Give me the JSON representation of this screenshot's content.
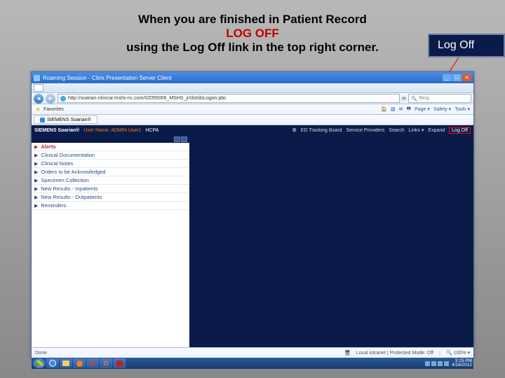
{
  "slide": {
    "line1": "When you are finished in Patient Record",
    "logoff": "LOG OFF",
    "line3": "using the Log Off link in the top right corner."
  },
  "callout": {
    "label": "Log Off"
  },
  "window": {
    "title": "Roaming Session - Citrix Presentation Server Client",
    "min": "_",
    "max": "☐",
    "close": "✕"
  },
  "ie": {
    "tabbar_label": "SIEMENS Soarian®",
    "back": "◄",
    "forward": "►",
    "url": "http://soarian-clinical.mshs-nc.com/02055006_MSHS_jr/dst/dsLogon.pbc",
    "refresh": "⟳",
    "search_placeholder": "Bing",
    "fav_label": "Favorites",
    "toolbar_items": [
      "Page ▾",
      "Safety ▾",
      "Tools ▾"
    ],
    "toolbar_icons": [
      "home-icon",
      "feed-icon",
      "mail-icon",
      "print-icon"
    ]
  },
  "app": {
    "brand": "SIEMENS Soarian®",
    "user_label": "User Name: ADMIN User1",
    "hipaa": "HCPA",
    "header_right": [
      {
        "label": "ED Tracking Board"
      },
      {
        "label": "Service Providers"
      },
      {
        "label": "Search"
      },
      {
        "label": "Links ▾"
      },
      {
        "label": "Expand"
      }
    ],
    "logoff_label": "Log Off"
  },
  "sidebar": {
    "items": [
      {
        "label": "Alerts",
        "alert": true
      },
      {
        "label": "Clinical Documentation"
      },
      {
        "label": "Clinical Notes"
      },
      {
        "label": "Orders to be Acknowledged"
      },
      {
        "label": "Specimen Collection"
      },
      {
        "label": "New Results - Inpatients"
      },
      {
        "label": "New Results - Outpatients"
      },
      {
        "label": "Reminders"
      }
    ]
  },
  "status": {
    "done": "Done",
    "zone": "Local intranet | Protected Mode: Off",
    "zoom": "100%"
  },
  "taskbar": {
    "time": "3:15 PM",
    "date": "4/16/2012"
  }
}
